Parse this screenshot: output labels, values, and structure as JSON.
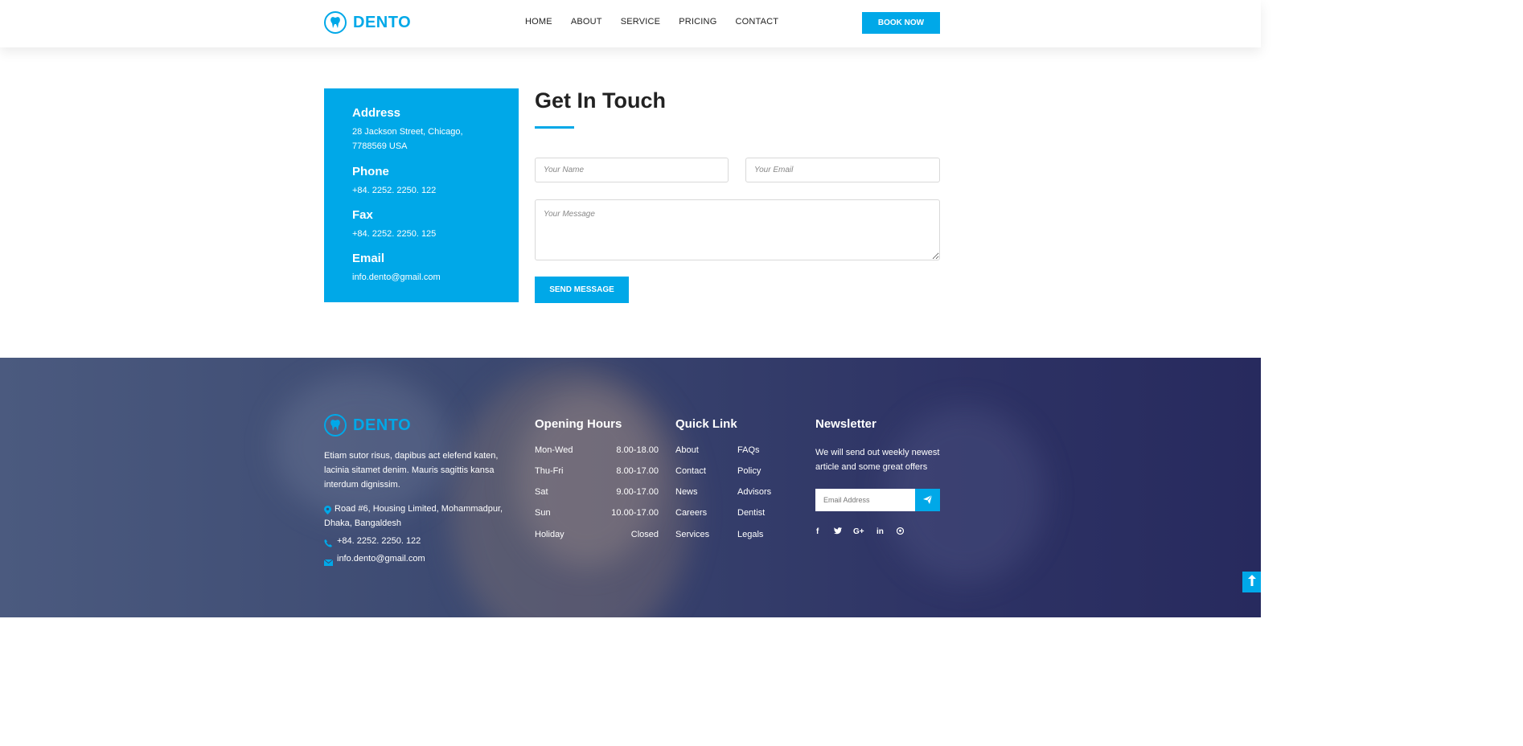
{
  "colors": {
    "accent": "#00a8e8",
    "footer_bg": "#2e3365"
  },
  "header": {
    "brand": "DENTO",
    "nav": [
      "HOME",
      "ABOUT",
      "SERVICE",
      "PRICING",
      "CONTACT"
    ],
    "book_label": "BOOK NOW"
  },
  "contact_info": {
    "address_label": "Address",
    "address_line1": "28 Jackson Street, Chicago,",
    "address_line2": "7788569 USA",
    "phone_label": "Phone",
    "phone_value": "+84. 2252. 2250. 122",
    "fax_label": "Fax",
    "fax_value": "+84. 2252. 2250. 125",
    "email_label": "Email",
    "email_value": "info.dento@gmail.com"
  },
  "form": {
    "title": "Get In Touch",
    "name_placeholder": "Your Name",
    "email_placeholder": "Your Email",
    "message_placeholder": "Your Message",
    "send_label": "SEND MESSAGE"
  },
  "footer": {
    "brand": "DENTO",
    "about_line1": "Etiam sutor risus, dapibus act elefend katen,",
    "about_line2": "lacinia sitamet denim. Mauris sagittis kansa",
    "about_line3": "interdum dignissim.",
    "address_line1": "Road #6, Housing Limited, Mohammadpur,",
    "address_line2": "Dhaka, Bangaldesh",
    "phone": "+84. 2252. 2250. 122",
    "email": "info.dento@gmail.com",
    "hours_title": "Opening Hours",
    "hours": [
      {
        "day": "Mon-Wed",
        "time": "8.00-18.00"
      },
      {
        "day": "Thu-Fri",
        "time": "8.00-17.00"
      },
      {
        "day": "Sat",
        "time": "9.00-17.00"
      },
      {
        "day": "Sun",
        "time": "10.00-17.00"
      },
      {
        "day": "Holiday",
        "time": "Closed"
      }
    ],
    "links_title": "Quick Link",
    "links_col1": [
      "About",
      "Contact",
      "News",
      "Careers",
      "Services"
    ],
    "links_col2": [
      "FAQs",
      "Policy",
      "Advisors",
      "Dentist",
      "Legals"
    ],
    "newsletter_title": "Newsletter",
    "newsletter_line1": "We will send out weekly newest",
    "newsletter_line2": "article and some great offers",
    "email_placeholder": "Email Address",
    "social": [
      "facebook-icon",
      "twitter-icon",
      "google-plus-icon",
      "linkedin-icon",
      "pinterest-icon"
    ]
  }
}
